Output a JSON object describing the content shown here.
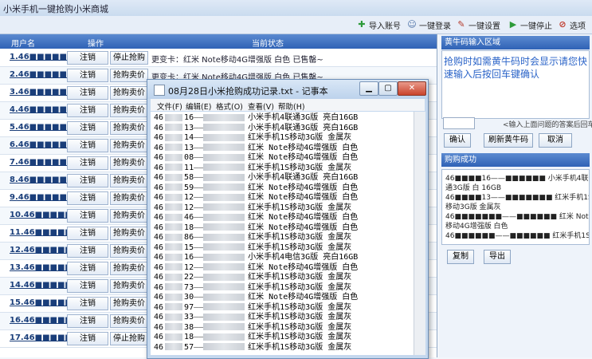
{
  "app": {
    "title": "小米手机一键抢购小米商城"
  },
  "toolbar": {
    "import_label": "导入账号",
    "login_label": "一键登录",
    "setting_label": "一键设置",
    "stop_label": "一键停止",
    "options_label": "选项"
  },
  "table": {
    "headers": {
      "user": "用户名",
      "op": "操作",
      "status": "当前状态"
    },
    "rows": [
      {
        "user": "1.46■■■■■50",
        "op": "注销",
        "btn": "停止抢购",
        "status": "更变卡：红米 Note移动4G增强版 白色 已售罄~"
      },
      {
        "user": "2.46■■■■■08",
        "op": "注销",
        "btn": "抢购卖价",
        "status": "更变卡：红米 Note移动4G增强版 白色 已售罄~"
      },
      {
        "user": "3.46■■■■■06",
        "op": "注销",
        "btn": "抢购卖价",
        "status": ""
      },
      {
        "user": "4.46■■■■■49",
        "op": "注销",
        "btn": "抢购卖价",
        "status": ""
      },
      {
        "user": "5.46■■■■■45",
        "op": "注销",
        "btn": "抢购卖价",
        "status": ""
      },
      {
        "user": "6.46■■■■■72",
        "op": "注销",
        "btn": "抢购卖价",
        "status": ""
      },
      {
        "user": "7.46■■■■■05",
        "op": "注销",
        "btn": "抢购卖价",
        "status": ""
      },
      {
        "user": "8.46■■■■■99",
        "op": "注销",
        "btn": "抢购卖价",
        "status": ""
      },
      {
        "user": "9.46■■■■■52",
        "op": "注销",
        "btn": "抢购卖价",
        "status": ""
      },
      {
        "user": "10.46■■■■■88",
        "op": "注销",
        "btn": "抢购卖价",
        "status": ""
      },
      {
        "user": "11.46■■■■■12",
        "op": "注销",
        "btn": "抢购卖价",
        "status": ""
      },
      {
        "user": "12.46■■■■■12",
        "op": "注销",
        "btn": "抢购卖价",
        "status": ""
      },
      {
        "user": "13.46■■■■■57",
        "op": "注销",
        "btn": "抢购卖价",
        "status": ""
      },
      {
        "user": "14.46■■■■■58",
        "op": "注销",
        "btn": "抢购卖价",
        "status": ""
      },
      {
        "user": "15.46■■■■■35",
        "op": "注销",
        "btn": "抢购卖价",
        "status": ""
      },
      {
        "user": "16.46■■■■■57",
        "op": "注销",
        "btn": "抢购卖价",
        "status": ""
      },
      {
        "user": "17.46■■■■■44",
        "op": "注销",
        "btn": "停止抢购",
        "status": ""
      }
    ]
  },
  "right": {
    "captcha_title": "黄牛码输入区域",
    "captcha_text": "抢购时如需黄牛码时会显示请您快速输入后按回车键确认",
    "captcha_hint": "<输入上面问题的答案后回车",
    "confirm_label": "确认",
    "refresh_label": "刷新黄牛码",
    "cancel_label": "取消",
    "success_title": "购购成功",
    "success_lines": [
      "46■■■■16——■■■■■■ 小米手机4联",
      "通3G版 白 16GB",
      "46■■■■13——■■■■■■■ 红米手机1S",
      "移动3G版 金属灰",
      "46■■■■■■■——■■■■■■ 红米 Note",
      "移动4G增强版 白色",
      "46■■■■■■——■■■■■■ 红米手机1S"
    ],
    "copy_label": "复制",
    "export_label": "导出"
  },
  "notepad": {
    "title": "08月28日小米抢购成功记录.txt - 记事本",
    "menu": [
      "文件(F)",
      "编辑(E)",
      "格式(O)",
      "查看(V)",
      "帮助(H)"
    ],
    "lines": [
      {
        "id": "46",
        "pw": "16",
        "product": "小米手机4联通3G版 亮白16GB"
      },
      {
        "id": "46",
        "pw": "13",
        "product": "小米手机4联通3G版 亮白16GB"
      },
      {
        "id": "46",
        "pw": "14",
        "product": "红米手机1S移动3G版 金属灰"
      },
      {
        "id": "46",
        "pw": "13",
        "product": "红米 Note移动4G增强版 白色"
      },
      {
        "id": "46",
        "pw": "08",
        "product": "红米 Note移动4G增强版 白色"
      },
      {
        "id": "46",
        "pw": "11",
        "product": "红米手机1S移动3G版 金属灰"
      },
      {
        "id": "46",
        "pw": "58",
        "product": "小米手机4联通3G版 亮白16GB"
      },
      {
        "id": "46",
        "pw": "59",
        "product": "红米 Note移动4G增强版 白色"
      },
      {
        "id": "46",
        "pw": "12",
        "product": "红米 Note移动4G增强版 白色"
      },
      {
        "id": "46",
        "pw": "12",
        "product": "红米手机1S移动3G版 金属灰"
      },
      {
        "id": "46",
        "pw": "46",
        "product": "红米 Note移动4G增强版 白色"
      },
      {
        "id": "46",
        "pw": "18",
        "product": "红米 Note移动4G增强版 白色"
      },
      {
        "id": "46",
        "pw": "86",
        "product": "红米手机1S移动3G版 金属灰"
      },
      {
        "id": "46",
        "pw": "15",
        "product": "红米手机1S移动3G版 金属灰"
      },
      {
        "id": "46",
        "pw": "16",
        "product": "小米手机4电信3G版 亮白16GB"
      },
      {
        "id": "46",
        "pw": "12",
        "product": "红米 Note移动4G增强版 白色"
      },
      {
        "id": "46",
        "pw": "22",
        "product": "红米手机1S移动3G版 金属灰"
      },
      {
        "id": "46",
        "pw": "73",
        "product": "红米手机1S移动3G版 金属灰"
      },
      {
        "id": "46",
        "pw": "30",
        "product": "红米 Note移动4G增强版 白色"
      },
      {
        "id": "46",
        "pw": "97",
        "product": "红米手机1S移动3G版 金属灰"
      },
      {
        "id": "46",
        "pw": "33",
        "product": "红米手机1S移动3G版 金属灰"
      },
      {
        "id": "46",
        "pw": "38",
        "product": "红米手机1S移动3G版 金属灰"
      },
      {
        "id": "46",
        "pw": "18",
        "product": "红米手机1S移动3G版 金属灰"
      },
      {
        "id": "46",
        "pw": "57",
        "product": "红米手机1S移动3G版 金属灰"
      }
    ]
  },
  "colors": {
    "header_blue": "#2f62b6",
    "link_blue": "#2b64c8"
  }
}
